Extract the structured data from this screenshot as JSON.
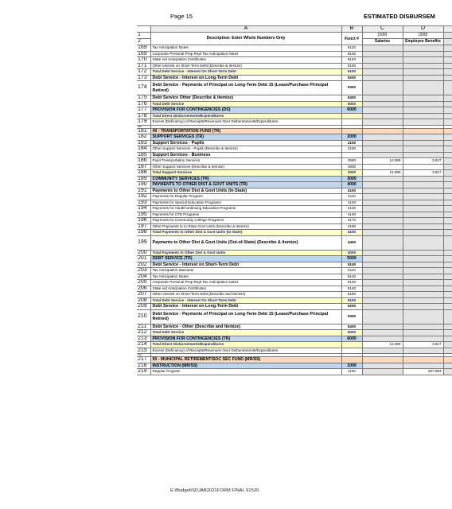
{
  "page_label": "Page 15",
  "header_title": "ESTIMATED DISBURSEM",
  "columns": {
    "rn": "",
    "a": "A",
    "b": "B",
    "c": "C",
    "d": "D",
    "e": ""
  },
  "header_row": {
    "rn": "1",
    "rn2": "2",
    "description": "Description: Enter Whole Numbers Only",
    "funct": "Funct #",
    "c_code": "(100)",
    "c_label": "Salaries",
    "d_code": "(200)",
    "d_label": "Employee Benefits"
  },
  "rows": [
    {
      "rn": "169",
      "desc": "Tax Anticipation Notes",
      "funct": "5120",
      "c": "",
      "d": "",
      "style": "",
      "c_gray": true,
      "d_gray": true
    },
    {
      "rn": "169",
      "desc": "Corporate Personal Prop Repl Tax Anticipation Notes",
      "funct": "5130",
      "c": "",
      "d": "",
      "style": "",
      "c_gray": true,
      "d_gray": true
    },
    {
      "rn": "170",
      "desc": "State Aid Anticipation Certificates",
      "funct": "5140",
      "c": "",
      "d": "",
      "style": "",
      "c_gray": true,
      "d_gray": true
    },
    {
      "rn": "171",
      "desc": "Other Interest on Short-Term Debt (Describe & Itemize)",
      "funct": "5150",
      "c": "",
      "d": "",
      "style": "",
      "c_gray": true,
      "d_gray": true
    },
    {
      "rn": "172",
      "desc": "Total Debt Service - Interest On Short-Term Debt",
      "funct": "5100",
      "c": "",
      "d": "",
      "style": "tot",
      "c_gray": true,
      "d_gray": true
    },
    {
      "rn": "173",
      "desc": "Debt Service - Interest on Long-Term Debt",
      "funct": "5200",
      "c": "",
      "d": "",
      "style": "bh",
      "c_gray": true,
      "d_gray": true
    },
    {
      "rn": "174",
      "desc": "Debt Service - Payments of Principal on Long-Term Debt 15 (Lease/Purchase Principal Retired)",
      "funct": "5300",
      "c": "",
      "d": "",
      "style": "bh tall2",
      "c_gray": true,
      "d_gray": true
    },
    {
      "rn": "175",
      "desc": "Debt Service Other (Describe & Itemize)",
      "funct": "5400",
      "c": "",
      "d": "",
      "style": "bh",
      "c_gray": true,
      "d_gray": true
    },
    {
      "rn": "176",
      "desc": "Total Debt Service",
      "funct": "5000",
      "c": "",
      "d": "",
      "style": "tot",
      "c_gray": true,
      "d_gray": true
    },
    {
      "rn": "177",
      "desc": "PROVISION FOR CONTINGENCIES (DS)",
      "funct": "6000",
      "c": "",
      "d": "",
      "style": "sec",
      "c_gray": true,
      "d_gray": true
    },
    {
      "rn": "178",
      "desc": "Total Direct Disbursements/Expenditures",
      "funct": "",
      "c": "",
      "d": "",
      "style": "tot",
      "c_gray": true,
      "d_gray": true
    },
    {
      "rn": "179",
      "desc": "Excess (Deficiency) of Receipts/Revenues Over Disbursements/Expenditures",
      "funct": "",
      "c": "",
      "d": "",
      "style": "",
      "c_gray": true,
      "d_gray": true
    },
    {
      "rn": "180",
      "desc": "",
      "funct": "",
      "c": "",
      "d": "",
      "style": "thin empty",
      "c_gray": false,
      "d_gray": false
    },
    {
      "rn": "181",
      "desc": "40 - TRANSPORTATION FUND (TR)",
      "funct": "",
      "c": "",
      "d": "",
      "style": "fund",
      "c_gray": false,
      "d_gray": false
    },
    {
      "rn": "182",
      "desc": "SUPPORT SERVICES (TR)",
      "funct": "2000",
      "c": "",
      "d": "",
      "style": "sec",
      "c_gray": true,
      "d_gray": true
    },
    {
      "rn": "183",
      "desc": "Support Services - Pupils",
      "funct": "2100",
      "c": "",
      "d": "",
      "style": "bh",
      "c_gray": true,
      "d_gray": true
    },
    {
      "rn": "184",
      "desc": "Other Support Services - Pupils (Describe & Itemize)",
      "funct": "2190",
      "c": "",
      "d": "",
      "style": "",
      "c_gray": true,
      "d_gray": true
    },
    {
      "rn": "185",
      "desc": "Support Services - Business",
      "funct": "",
      "c": "",
      "d": "",
      "style": "bh",
      "c_gray": true,
      "d_gray": true
    },
    {
      "rn": "186",
      "desc": "Pupil Transportation Services",
      "funct": "2550",
      "c": "12,980",
      "d": "3,827",
      "style": "",
      "c_gray": false,
      "d_gray": false
    },
    {
      "rn": "187",
      "desc": "Other Support Services (Describe & Itemize)",
      "funct": "2900",
      "c": "",
      "d": "",
      "style": "",
      "c_gray": false,
      "d_gray": false
    },
    {
      "rn": "188",
      "desc": "Total Support Services",
      "funct": "2000",
      "c": "12,980",
      "d": "3,827",
      "style": "tot",
      "c_gray": false,
      "d_gray": false
    },
    {
      "rn": "189",
      "desc": "COMMUNITY SERVICES (TR)",
      "funct": "3000",
      "c": "",
      "d": "",
      "style": "sec",
      "c_gray": true,
      "d_gray": true
    },
    {
      "rn": "190",
      "desc": "PAYMENTS TO OTHER DIST & GOVT UNITS (TR)",
      "funct": "4000",
      "c": "",
      "d": "",
      "style": "sec",
      "c_gray": true,
      "d_gray": true
    },
    {
      "rn": "191",
      "desc": "Payments to Other Dist & Govt Units (In-State)",
      "funct": "4100",
      "c": "",
      "d": "",
      "style": "bh",
      "c_gray": true,
      "d_gray": true
    },
    {
      "rn": "192",
      "desc": "Payments for Regular Program",
      "funct": "4110",
      "c": "",
      "d": "",
      "style": "",
      "c_gray": true,
      "d_gray": true
    },
    {
      "rn": "193",
      "desc": "Payments for Special Education Programs",
      "funct": "4120",
      "c": "",
      "d": "",
      "style": "",
      "c_gray": true,
      "d_gray": true
    },
    {
      "rn": "194",
      "desc": "Payments for Adult/Continuing Education Programs",
      "funct": "4130",
      "c": "",
      "d": "",
      "style": "",
      "c_gray": true,
      "d_gray": true
    },
    {
      "rn": "195",
      "desc": "Payments for CTE Programs",
      "funct": "4140",
      "c": "",
      "d": "",
      "style": "",
      "c_gray": true,
      "d_gray": true
    },
    {
      "rn": "196",
      "desc": "Payments for Community College Programs",
      "funct": "4170",
      "c": "",
      "d": "",
      "style": "",
      "c_gray": true,
      "d_gray": true
    },
    {
      "rn": "197",
      "desc": "Other Payments to In-State Govt Units (Describe & Itemize)",
      "funct": "4190",
      "c": "",
      "d": "",
      "style": "",
      "c_gray": true,
      "d_gray": true
    },
    {
      "rn": "198",
      "desc": "Total Payments to Other Dist & Govt Units (In-State)",
      "funct": "4100",
      "c": "",
      "d": "",
      "style": "tot",
      "c_gray": true,
      "d_gray": true
    },
    {
      "rn": "199",
      "desc": "Payments to Other Dist & Govt Units (Out-of-State)                    (Describe & Itemize)",
      "funct": "4400",
      "c": "",
      "d": "",
      "style": "bh tall2",
      "c_gray": true,
      "d_gray": true
    },
    {
      "rn": "200",
      "desc": "Total Payments to Other Dist & Govt Units",
      "funct": "4000",
      "c": "",
      "d": "",
      "style": "tot",
      "c_gray": true,
      "d_gray": true
    },
    {
      "rn": "201",
      "desc": "DEBT SERVICE (TR)",
      "funct": "5000",
      "c": "",
      "d": "",
      "style": "sec",
      "c_gray": true,
      "d_gray": true
    },
    {
      "rn": "202",
      "desc": "Debt Service - Interest on Short-Term Debt",
      "funct": "5100",
      "c": "",
      "d": "",
      "style": "bh",
      "c_gray": true,
      "d_gray": true
    },
    {
      "rn": "203",
      "desc": "Tax Anticipation Warrants",
      "funct": "5110",
      "c": "",
      "d": "",
      "style": "",
      "c_gray": true,
      "d_gray": true
    },
    {
      "rn": "204",
      "desc": "Tax Anticipation Notes",
      "funct": "5120",
      "c": "",
      "d": "",
      "style": "",
      "c_gray": true,
      "d_gray": true
    },
    {
      "rn": "205",
      "desc": "Corporate Personal Prop Repl Tax Anticipation Notes",
      "funct": "5130",
      "c": "",
      "d": "",
      "style": "",
      "c_gray": true,
      "d_gray": true
    },
    {
      "rn": "206",
      "desc": "State Aid Anticipation Certificates",
      "funct": "5140",
      "c": "",
      "d": "",
      "style": "",
      "c_gray": true,
      "d_gray": true
    },
    {
      "rn": "207",
      "desc": "Other Interest on Short-Term Debt (Describe and Itemize)",
      "funct": "5150",
      "c": "",
      "d": "",
      "style": "",
      "c_gray": true,
      "d_gray": true
    },
    {
      "rn": "208",
      "desc": "Total Debt Service - Interest On Short-Term Debt",
      "funct": "5100",
      "c": "",
      "d": "",
      "style": "tot",
      "c_gray": true,
      "d_gray": true
    },
    {
      "rn": "209",
      "desc": "Debt Service - Interest on Long-Term Debt",
      "funct": "5200",
      "c": "",
      "d": "",
      "style": "bh",
      "c_gray": true,
      "d_gray": true
    },
    {
      "rn": "210",
      "desc": "Debt Service - Payments of Principal on Long-Term Debt 15 (Lease/Purchase Principal Retired)",
      "funct": "5300",
      "c": "",
      "d": "",
      "style": "bh tall2",
      "c_gray": true,
      "d_gray": true
    },
    {
      "rn": "211",
      "desc": "Debt Service - Other (Describe and Itemize)",
      "funct": "5400",
      "c": "",
      "d": "",
      "style": "bh",
      "c_gray": true,
      "d_gray": true
    },
    {
      "rn": "212",
      "desc": "Total Debt Service",
      "funct": "5000",
      "c": "",
      "d": "",
      "style": "tot",
      "c_gray": true,
      "d_gray": true
    },
    {
      "rn": "213",
      "desc": "PROVISION FOR CONTINGENCIES (TR)",
      "funct": "6000",
      "c": "",
      "d": "",
      "style": "sec",
      "c_gray": true,
      "d_gray": true
    },
    {
      "rn": "214",
      "desc": "Total Direct Disbursements/Expenditures",
      "funct": "",
      "c": "12,980",
      "d": "3,827",
      "style": "tot",
      "c_gray": false,
      "d_gray": false
    },
    {
      "rn": "215",
      "desc": "Excess (Deficiency) of Receipts/Revenues Over Disbursements/Expenditures",
      "funct": "",
      "c": "",
      "d": "",
      "style": "",
      "c_gray": true,
      "d_gray": true
    },
    {
      "rn": "216",
      "desc": "",
      "funct": "",
      "c": "",
      "d": "",
      "style": "thin empty",
      "c_gray": false,
      "d_gray": false
    },
    {
      "rn": "217",
      "desc": "50 - MUNICIPAL RETIREMENT/SOC SEC FUND (MR/SS)",
      "funct": "",
      "c": "",
      "d": "",
      "style": "fund",
      "c_gray": false,
      "d_gray": false
    },
    {
      "rn": "218",
      "desc": "INSTRUCTION (MR/SS)",
      "funct": "1000",
      "c": "",
      "d": "",
      "style": "sec",
      "c_gray": true,
      "d_gray": true
    },
    {
      "rn": "219",
      "desc": "Regular Program",
      "funct": "1100",
      "c": "",
      "d": "287,963",
      "style": "",
      "c_gray": true,
      "d_gray": false
    }
  ],
  "footer": "E:\\Budget\\SDJAB2021FORM FINAL 91520"
}
